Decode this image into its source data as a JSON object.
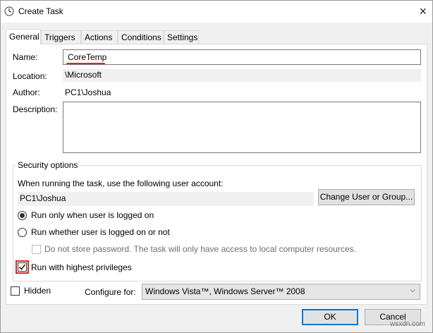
{
  "window": {
    "title": "Create Task",
    "close_glyph": "×"
  },
  "tabs": [
    {
      "label": "General",
      "active": true
    },
    {
      "label": "Triggers"
    },
    {
      "label": "Actions"
    },
    {
      "label": "Conditions"
    },
    {
      "label": "Settings"
    }
  ],
  "general": {
    "name_label": "Name:",
    "name_value": "CoreTemp",
    "location_label": "Location:",
    "location_value": "\\Microsoft",
    "author_label": "Author:",
    "author_value": "PC1\\Joshua",
    "description_label": "Description:",
    "description_value": ""
  },
  "security": {
    "legend": "Security options",
    "account_prompt": "When running the task, use the following user account:",
    "account_value": "PC1\\Joshua",
    "change_user_button": "Change User or Group...",
    "radio_logged_on": "Run only when user is logged on",
    "radio_logged_on_or_not": "Run whether user is logged on or not",
    "no_store_password": "Do not store password.  The task will only have access to local computer resources.",
    "highest_privileges": "Run with highest privileges"
  },
  "footer": {
    "hidden_label": "Hidden",
    "configure_label": "Configure for:",
    "configure_value": "Windows Vista™, Windows Server™ 2008",
    "ok_button": "OK",
    "cancel_button": "Cancel"
  },
  "watermark": "wsxdn.com",
  "colors": {
    "annotation_red": "#d9262b",
    "default_button_border": "#0078d7"
  },
  "icons": {
    "app": "clock-icon",
    "close": "close-icon",
    "dropdown": "chevron-down-icon",
    "checkmark": "checkmark-icon"
  }
}
